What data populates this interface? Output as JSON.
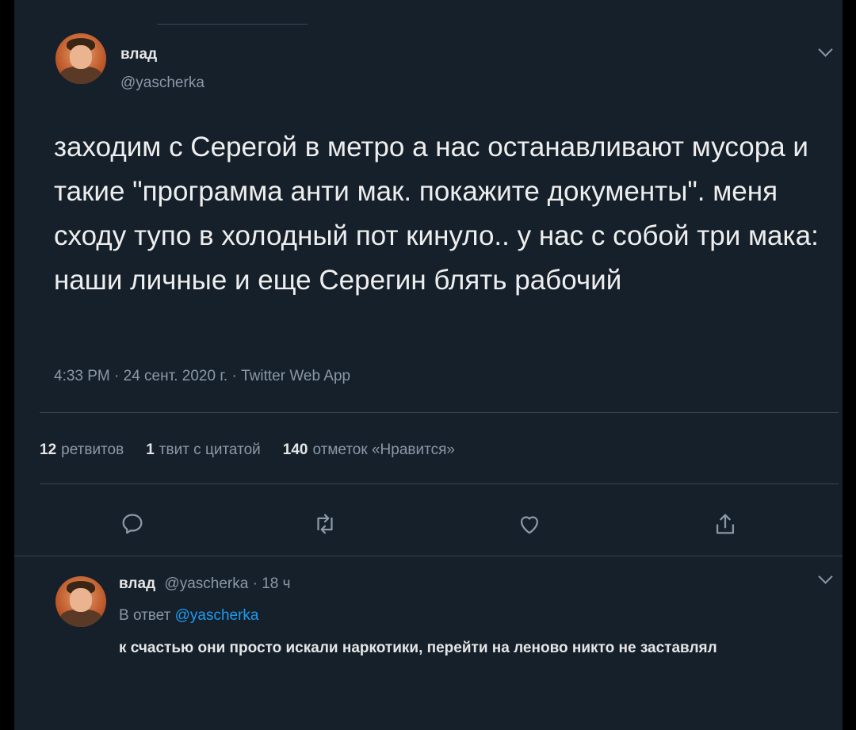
{
  "tweet": {
    "author_name": "влад",
    "author_handle": "@yascherka",
    "text": "заходим с Серегой в метро а нас останавливают мусора и такие \"программа анти мак. покажите документы\". меня сходу тупо в холодный пот кинуло.. у нас с собой три мака: наши личные и еще Серегин блять рабочий",
    "meta": "4:33 PM · 24 сент. 2020 г. · Twitter Web App",
    "stats": {
      "retweets_count": "12",
      "retweets_label": "ретвитов",
      "quotes_count": "1",
      "quotes_label": "твит с цитатой",
      "likes_count": "140",
      "likes_label": "отметок «Нравится»"
    },
    "actions": [
      "reply-icon",
      "retweet-icon",
      "like-icon",
      "share-icon"
    ]
  },
  "reply": {
    "author_name": "влад",
    "author_handle": "@yascherka",
    "time": "· 18 ч",
    "reply_to_prefix": "В ответ",
    "reply_to_handle": "@yascherka",
    "text": "к счастью они просто искали наркотики, перейти на леново никто не заставлял"
  },
  "colors": {
    "background": "#15202b",
    "text": "#eeeeee",
    "muted": "#8b98a5",
    "accent": "#1d9bf0",
    "divider": "#38444d"
  }
}
